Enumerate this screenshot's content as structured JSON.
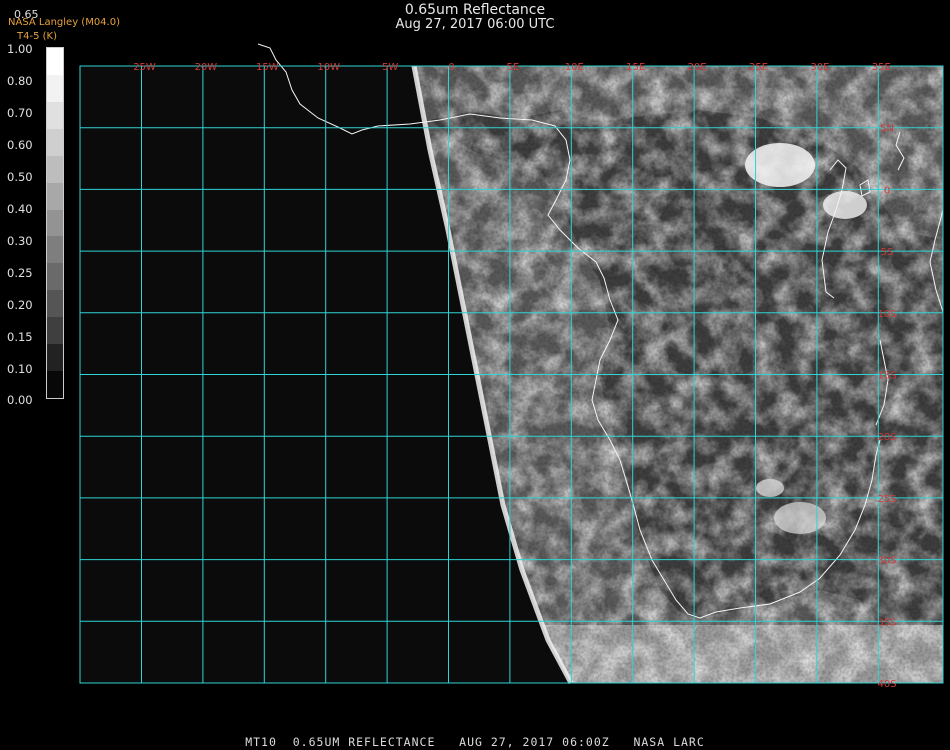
{
  "title": "0.65um Reflectance",
  "subtitle": "Aug 27, 2017 06:00 UTC",
  "top_left": {
    "value_label": "0.65",
    "source": "NASA Langley (M04.0)",
    "overlay": "T4-5 (K)"
  },
  "colorbar": {
    "labels": [
      "1.00",
      "0.80",
      "0.70",
      "0.60",
      "0.50",
      "0.40",
      "0.30",
      "0.25",
      "0.20",
      "0.15",
      "0.10",
      "0.00"
    ],
    "shades": [
      "#ffffff",
      "#f2f2f2",
      "#e0e0e0",
      "#cfcfcf",
      "#bdbdbd",
      "#a8a8a8",
      "#939393",
      "#7e7e7e",
      "#6a6a6a",
      "#555555",
      "#3f3f3f",
      "#222222",
      "#080808"
    ]
  },
  "map": {
    "grid_color": "#2fd4d4",
    "label_color": "#d43a3a",
    "lon_labels": [
      "25W",
      "20W",
      "15W",
      "10W",
      "5W",
      "0",
      "5E",
      "10E",
      "15E",
      "20E",
      "25E",
      "30E",
      "35E"
    ],
    "lat_labels": [
      "5N",
      "0",
      "5S",
      "10S",
      "15S",
      "20S",
      "25S",
      "30S",
      "35S",
      "40S"
    ]
  },
  "footer": "MT10  0.65UM REFLECTANCE   AUG 27, 2017 06:00Z   NASA LARC"
}
